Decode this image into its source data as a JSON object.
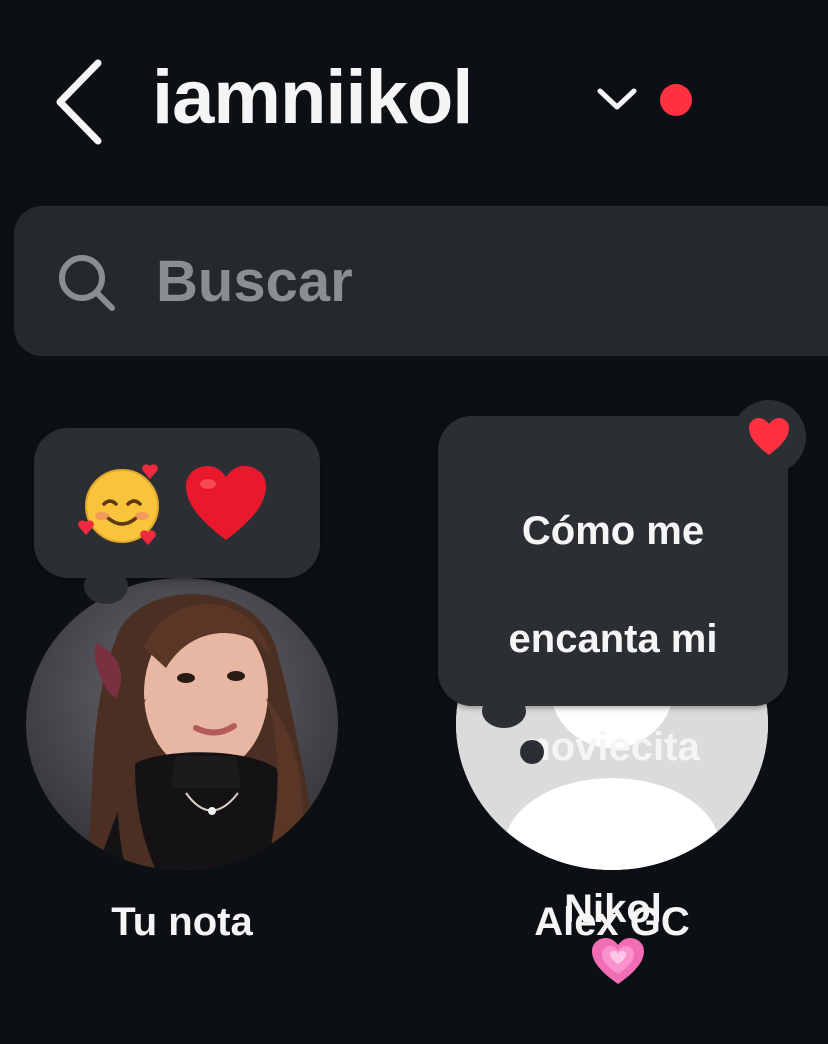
{
  "header": {
    "username": "iamniikol",
    "back_icon": "chevron-left-icon",
    "switch_icon": "chevron-down-icon",
    "notification_color": "#ff3040"
  },
  "search": {
    "placeholder": "Buscar",
    "icon": "search-icon"
  },
  "notes": [
    {
      "label": "Tu nota",
      "note_emojis": [
        "smiling-face-with-hearts-icon",
        "red-heart-icon"
      ],
      "avatar": "profile-photo"
    },
    {
      "label": "Alex GC",
      "note_lines": [
        "Cómo me",
        "encanta mi",
        "noviecita",
        "Nikol"
      ],
      "note_emoji": "growing-heart-icon",
      "liked": true,
      "avatar": "default-avatar"
    }
  ],
  "colors": {
    "background": "#0c1014",
    "search_bg": "#25292e",
    "bubble_bg": "#2b2f33",
    "placeholder": "#8a8d91",
    "like_red": "#ff3040"
  }
}
